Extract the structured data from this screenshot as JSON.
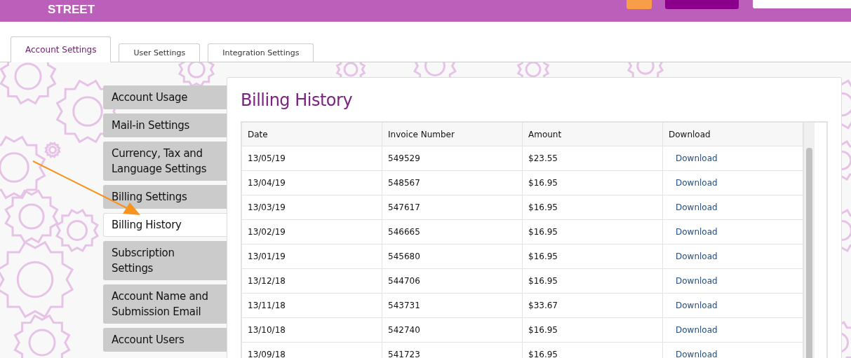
{
  "header": {
    "logo_text": "STREET"
  },
  "tabs": [
    {
      "label": "Account Settings",
      "selected": true
    },
    {
      "label": "User Settings",
      "selected": false
    },
    {
      "label": "Integration Settings",
      "selected": false
    }
  ],
  "sidebar": {
    "items": [
      {
        "label": "Account Usage",
        "selected": false
      },
      {
        "label": "Mail-in Settings",
        "selected": false
      },
      {
        "label": "Currency, Tax and Language Settings",
        "selected": false
      },
      {
        "label": "Billing Settings",
        "selected": false
      },
      {
        "label": "Billing History",
        "selected": true
      },
      {
        "label": "Subscription Settings",
        "selected": false
      },
      {
        "label": "Account Name and Submission Email",
        "selected": false
      },
      {
        "label": "Account Users",
        "selected": false
      }
    ]
  },
  "panel": {
    "title": "Billing History",
    "table": {
      "columns": [
        "Date",
        "Invoice Number",
        "Amount",
        "Download"
      ],
      "rows": [
        [
          "13/05/19",
          "549529",
          "$23.55",
          "Download"
        ],
        [
          "13/04/19",
          "548567",
          "$16.95",
          "Download"
        ],
        [
          "13/03/19",
          "547617",
          "$16.95",
          "Download"
        ],
        [
          "13/02/19",
          "546665",
          "$16.95",
          "Download"
        ],
        [
          "13/01/19",
          "545680",
          "$16.95",
          "Download"
        ],
        [
          "13/12/18",
          "544706",
          "$16.95",
          "Download"
        ],
        [
          "13/11/18",
          "543731",
          "$33.67",
          "Download"
        ],
        [
          "13/10/18",
          "542740",
          "$16.95",
          "Download"
        ],
        [
          "13/09/18",
          "541723",
          "$16.95",
          "Download"
        ]
      ]
    }
  }
}
